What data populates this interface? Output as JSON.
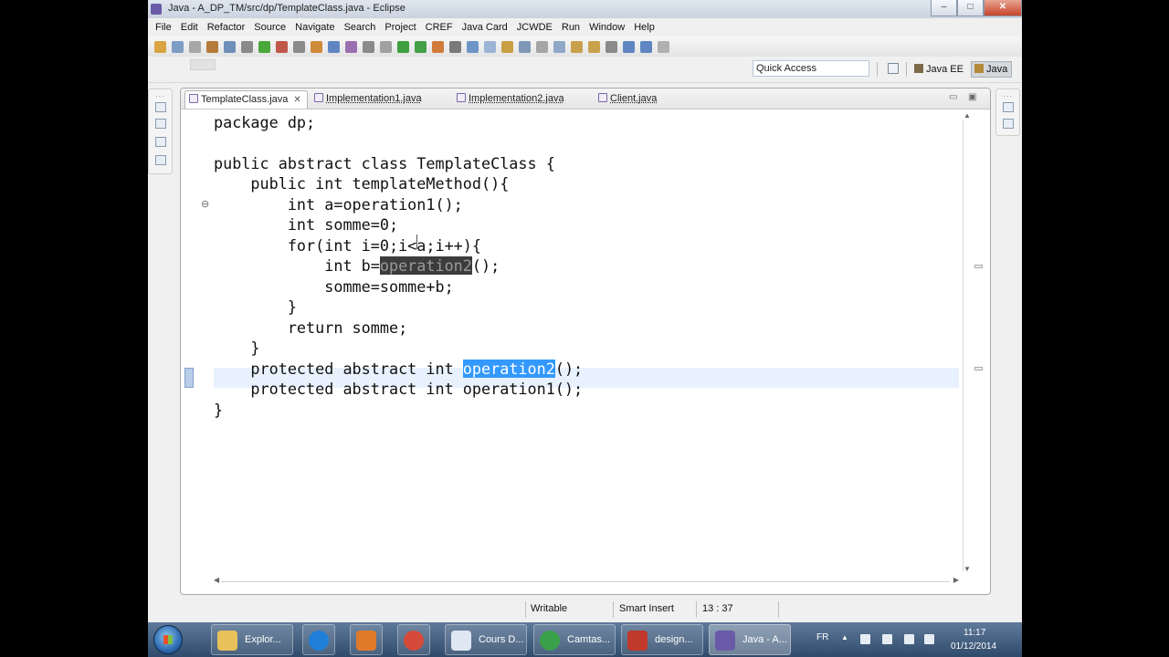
{
  "window": {
    "title": "Java - A_DP_TM/src/dp/TemplateClass.java - Eclipse",
    "controls": [
      "–",
      "□",
      "✕"
    ]
  },
  "menu": [
    "File",
    "Edit",
    "Refactor",
    "Source",
    "Navigate",
    "Search",
    "Project",
    "CREF",
    "Java Card",
    "JCWDE",
    "Run",
    "Window",
    "Help"
  ],
  "quick_access": {
    "placeholder": "Quick Access"
  },
  "perspectives": [
    {
      "label": "Java EE",
      "active": false
    },
    {
      "label": "Java",
      "active": true
    }
  ],
  "tabs": [
    {
      "label": "TemplateClass.java",
      "active": true,
      "close": "✕"
    },
    {
      "label": "Implementation1.java",
      "active": false
    },
    {
      "label": "Implementation2.java",
      "active": false
    },
    {
      "label": "Client.java",
      "active": false
    }
  ],
  "editor_controls": {
    "minimize": "▭",
    "maximize": "▣"
  },
  "code": {
    "lines": [
      "package dp;",
      "",
      "public abstract class TemplateClass {",
      "    public int templateMethod(){",
      "        int a=operation1();",
      "        int somme=0;",
      "        for(int i=0;i<a;i++){",
      "            int b=",
      "            somme=somme+b;",
      "        }",
      "        return somme;",
      "    }",
      "    protected abstract int ",
      "    protected abstract int operation1();",
      "}"
    ],
    "occurrence_word": "operation2",
    "line8_suffix": "();",
    "line13_suffix": "();",
    "fold_marker": "⊖"
  },
  "status": {
    "writable": "Writable",
    "insert_mode": "Smart Insert",
    "position": "13 : 37"
  },
  "taskbar": {
    "items": [
      {
        "label": "Explor...",
        "color": "#e9c15a"
      },
      {
        "label": "",
        "color": "#1f7fd8"
      },
      {
        "label": "",
        "color": "#e07a2a"
      },
      {
        "label": "",
        "color": "#d64a3a"
      },
      {
        "label": "Cours D...",
        "color": "#dfe7f2"
      },
      {
        "label": "Camtas...",
        "color": "#3aa04a"
      },
      {
        "label": "design...",
        "color": "#c0392b"
      },
      {
        "label": "Java - A...",
        "color": "#6b5aa8"
      }
    ],
    "language": "FR",
    "time": "11:17",
    "date": "01/12/2014"
  },
  "colors": {
    "selection": "#3399ff",
    "occurrence_highlight": "#3c3c3c",
    "current_line": "#e8f2fe"
  }
}
